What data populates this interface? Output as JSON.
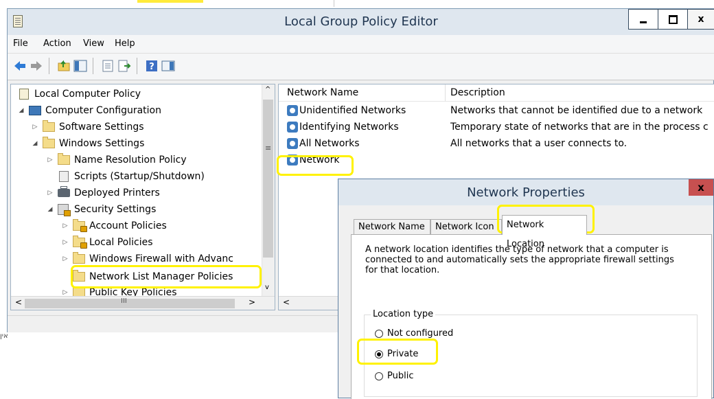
{
  "window": {
    "title": "Local Group Policy Editor",
    "minimize_glyph": "–",
    "maximize_glyph": "□",
    "close_glyph": "x"
  },
  "menu": [
    "File",
    "Action",
    "View",
    "Help"
  ],
  "toolbar": {
    "icons": [
      "back-arrow-icon",
      "forward-arrow-icon",
      "up-folder-icon",
      "show-hide-tree-icon",
      "properties-icon",
      "export-list-icon",
      "help-icon",
      "show-hide-action-pane-icon"
    ]
  },
  "tree": {
    "items": [
      {
        "label": "Local Computer Policy",
        "expander": ""
      },
      {
        "label": "Computer Configuration",
        "expander": "◢"
      },
      {
        "label": "Software Settings",
        "expander": "▷"
      },
      {
        "label": "Windows Settings",
        "expander": "◢"
      },
      {
        "label": "Name Resolution Policy",
        "expander": "▷"
      },
      {
        "label": "Scripts (Startup/Shutdown)",
        "expander": ""
      },
      {
        "label": "Deployed Printers",
        "expander": "▷"
      },
      {
        "label": "Security Settings",
        "expander": "◢"
      },
      {
        "label": "Account Policies",
        "expander": "▷"
      },
      {
        "label": "Local Policies",
        "expander": "▷"
      },
      {
        "label": "Windows Firewall with Advanc",
        "expander": "▷"
      },
      {
        "label": "Network List Manager Policies",
        "expander": ""
      },
      {
        "label": "Public Key Policies",
        "expander": "▷"
      }
    ],
    "hscroll_left": "<",
    "hscroll_right": ">",
    "hscroll_grip": "III",
    "vscroll_up": "^",
    "vscroll_down": "v",
    "vscroll_grip": "≡"
  },
  "list": {
    "columns": [
      "Network Name",
      "Description"
    ],
    "rows": [
      {
        "name": "Unidentified Networks",
        "description": "Networks that cannot be identified due to a network"
      },
      {
        "name": "Identifying Networks",
        "description": "Temporary state of networks that are in the process c"
      },
      {
        "name": "All Networks",
        "description": "All networks that a user connects to."
      },
      {
        "name": "Network",
        "description": ""
      }
    ],
    "hscroll_left": "<"
  },
  "below_window_text": "אין",
  "dialog": {
    "title": "Network Properties",
    "close_glyph": "x",
    "tabs": [
      "Network Name",
      "Network Icon",
      "Network Location"
    ],
    "active_tab": "Network Location",
    "description": "A network location identifies the type of network that a computer is connected to and automatically sets the appropriate firewall settings for that location.",
    "group_label": "Location type",
    "options": [
      {
        "label": "Not configured",
        "checked": false
      },
      {
        "label": "Private",
        "checked": true
      },
      {
        "label": "Public",
        "checked": false
      }
    ]
  },
  "colors": {
    "highlight": "#fff200",
    "titlebar": "#dfe7ef",
    "window_bg": "#f0f0f0"
  }
}
